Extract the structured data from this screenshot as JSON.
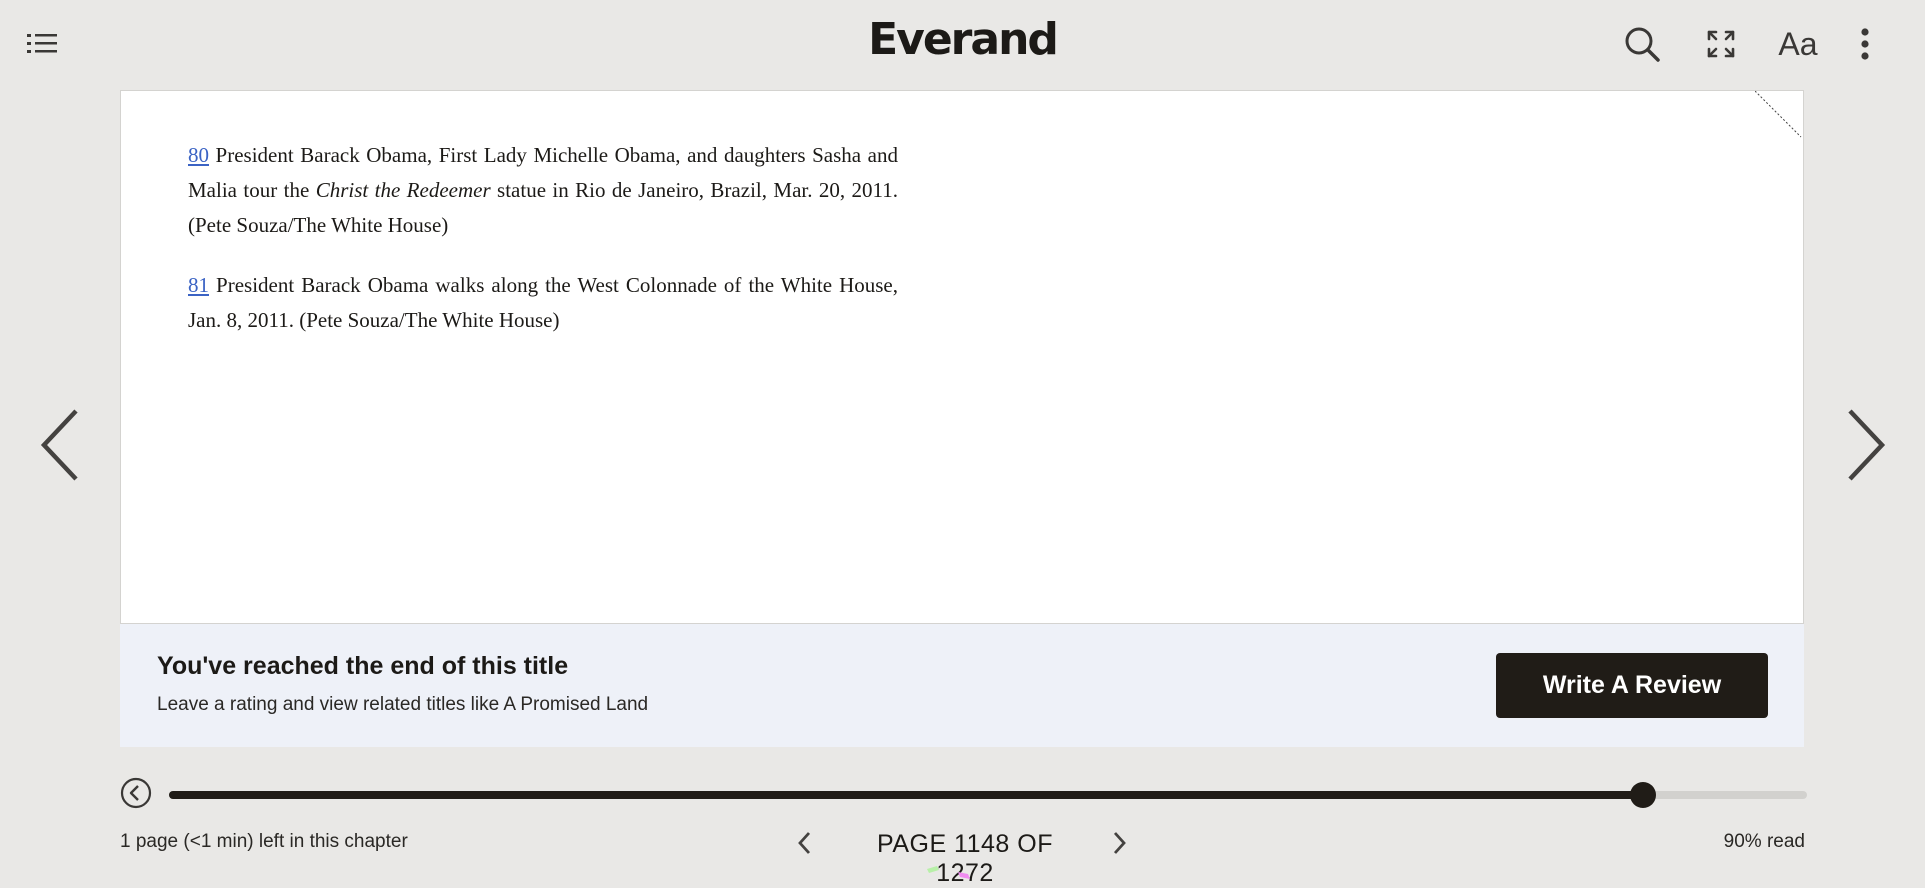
{
  "app": {
    "logo": "Everand"
  },
  "toolbar": {
    "font_label": "Aa",
    "icons": [
      "toc-icon",
      "search-icon",
      "fullscreen-icon",
      "font-settings",
      "more-options-icon"
    ]
  },
  "content": {
    "notes": [
      {
        "ref": "80",
        "text_before": "President Barack Obama, First Lady Michelle Obama, and daughters Sasha and Malia tour the ",
        "italic": "Christ the Redeemer",
        "text_after": " statue in Rio de Janeiro, Brazil, Mar. 20, 2011. (Pete Souza/The White House)"
      },
      {
        "ref": "81",
        "text_before": "President Barack Obama walks along the West Colonnade of the White House, Jan. 8, 2011. (Pete Souza/The White House)",
        "italic": "",
        "text_after": ""
      }
    ]
  },
  "end_banner": {
    "title": "You've reached the end of this title",
    "subtitle": "Leave a rating and view related titles like A Promised Land",
    "button_label": "Write A Review",
    "background": "#eef1f8",
    "button_color": "#201c17"
  },
  "progress": {
    "fraction": 0.9,
    "chapter_remaining": "1 page (<1 min) left in this chapter",
    "page_label": "PAGE 1148 OF 1272",
    "read_label": "90% read"
  },
  "colors": {
    "background": "#e9e8e6",
    "link": "#3b63c4",
    "accent_dark": "#201c17"
  }
}
